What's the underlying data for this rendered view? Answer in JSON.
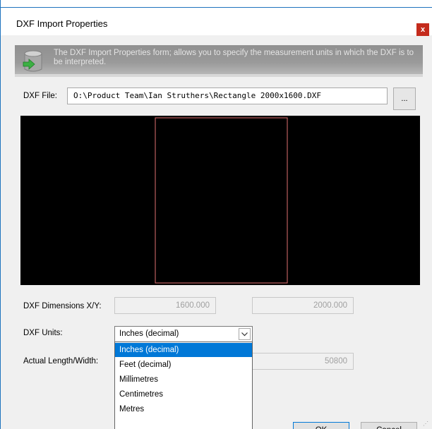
{
  "window": {
    "title": "DXF Import Properties",
    "close_label": "x"
  },
  "banner": {
    "icon": "database-import-icon",
    "text": "The DXF Import Properties form; allows you to specify the measurement units in which the DXF is to be interpreted."
  },
  "dxf_file": {
    "label": "DXF File:",
    "value": "O:\\Product Team\\Ian Struthers\\Rectangle 2000x1600.DXF",
    "browse_label": "..."
  },
  "dimensions": {
    "label": "DXF Dimensions X/Y:",
    "x": "1600.000",
    "y": "2000.000"
  },
  "units": {
    "label": "DXF Units:",
    "selected": "Inches (decimal)",
    "options": [
      "Inches (decimal)",
      "Feet (decimal)",
      "Millimetres",
      "Centimetres",
      "Metres"
    ]
  },
  "actual": {
    "label": "Actual Length/Width:",
    "length": "",
    "width": "50800"
  },
  "buttons": {
    "ok": "OK",
    "cancel": "Cancel"
  },
  "colors": {
    "accent": "#0078d7",
    "close": "#c42b1c",
    "preview_bg": "#000000",
    "preview_shape": "#e07070"
  }
}
